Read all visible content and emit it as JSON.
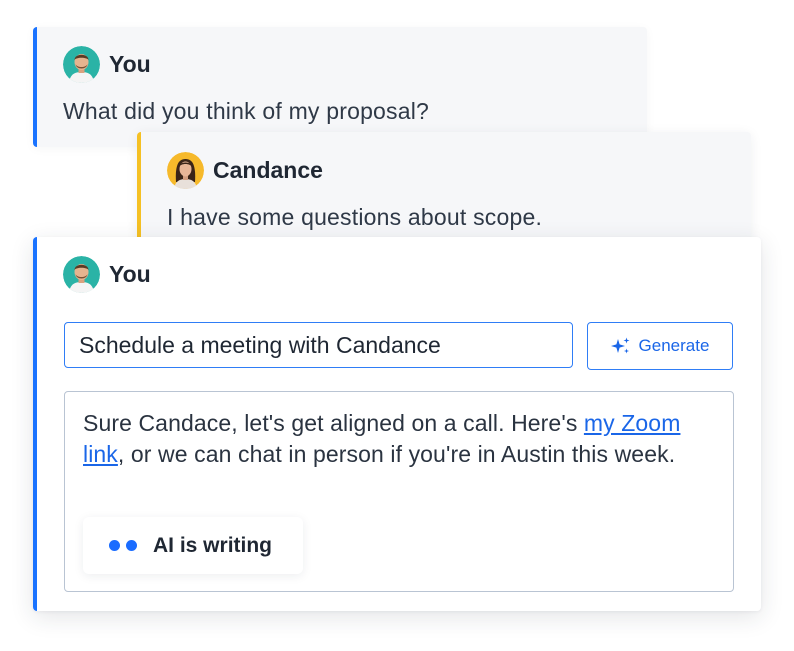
{
  "thread": {
    "message_1": {
      "author": "You",
      "text": "What did you think of my proposal?"
    },
    "message_2": {
      "author": "Candance",
      "text": "I have some questions about scope."
    }
  },
  "composer": {
    "author": "You",
    "prompt_value": "Schedule a meeting with Candance",
    "generate_label": "Generate",
    "draft": {
      "before_link": "Sure Candace, let's get aligned on a call. Here's ",
      "link_text": "my Zoom link",
      "after_link": ", or we can chat in person if you're in Austin this week."
    },
    "status_label": "AI is writing"
  },
  "colors": {
    "accent_you": "#1a73ff",
    "accent_candance": "#f5c023",
    "link": "#1a66e8"
  },
  "icons": {
    "generate": "sparkle-icon",
    "avatar_you": "avatar-man",
    "avatar_candance": "avatar-woman"
  }
}
